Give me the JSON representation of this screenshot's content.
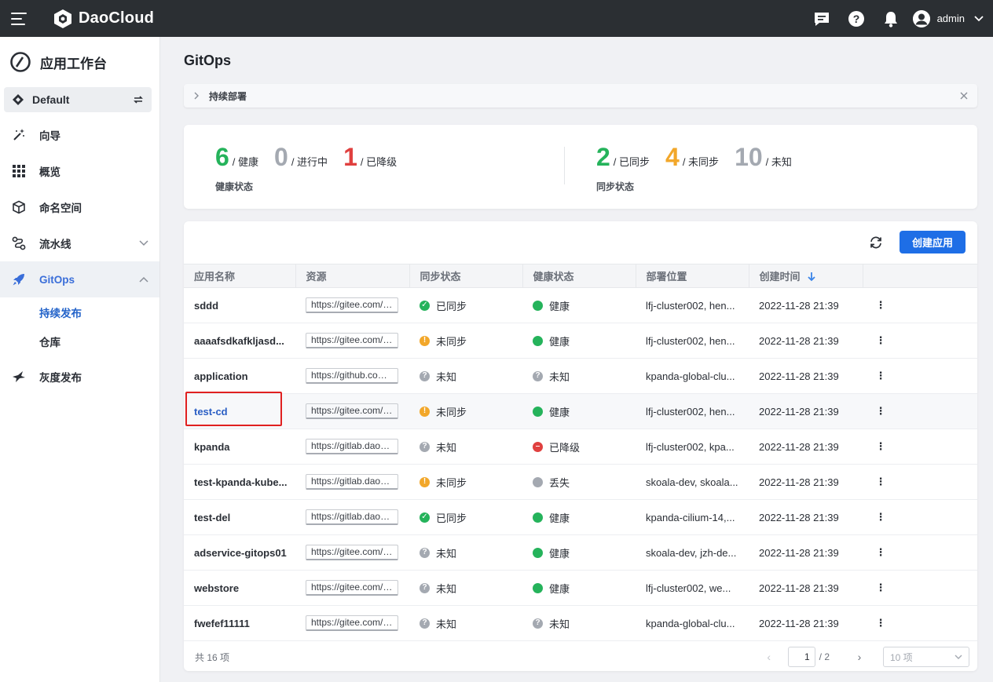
{
  "topbar": {
    "brand": "DaoCloud",
    "user": "admin"
  },
  "sidebar": {
    "title": "应用工作台",
    "workspace": "Default",
    "items": [
      {
        "label": "向导"
      },
      {
        "label": "概览"
      },
      {
        "label": "命名空间"
      },
      {
        "label": "流水线"
      },
      {
        "label": "GitOps"
      }
    ],
    "subitems": [
      {
        "label": "持续发布"
      },
      {
        "label": "仓库"
      }
    ],
    "last_item": "灰度发布"
  },
  "page": {
    "title": "GitOps",
    "breadcrumb": "持续部署"
  },
  "stats": {
    "health": {
      "caption": "健康状态",
      "items": [
        {
          "num": "6",
          "label": "/ 健康",
          "color": "#25b35b"
        },
        {
          "num": "0",
          "label": "/ 进行中",
          "color": "#a4a9b1"
        },
        {
          "num": "1",
          "label": "/ 已降级",
          "color": "#e0403f"
        }
      ]
    },
    "sync": {
      "caption": "同步状态",
      "items": [
        {
          "num": "2",
          "label": "/ 已同步",
          "color": "#25b35b"
        },
        {
          "num": "4",
          "label": "/ 未同步",
          "color": "#f2a72a"
        },
        {
          "num": "10",
          "label": "/ 未知",
          "color": "#a4a9b1"
        }
      ]
    }
  },
  "table": {
    "create_label": "创建应用",
    "columns": [
      "应用名称",
      "资源",
      "同步状态",
      "健康状态",
      "部署位置",
      "创建时间",
      ""
    ],
    "rows": [
      {
        "name": "sddd",
        "resource": "https://gitee.com/z...",
        "sync": "已同步",
        "sync_kind": "ok",
        "health": "健康",
        "health_kind": "healthy",
        "location": "lfj-cluster002, hen...",
        "created": "2022-11-28 21:39"
      },
      {
        "name": "aaaafsdkafkljasd...",
        "resource": "https://gitee.com/z...",
        "sync": "未同步",
        "sync_kind": "warn",
        "health": "健康",
        "health_kind": "healthy",
        "location": "lfj-cluster002, hen...",
        "created": "2022-11-28 21:39"
      },
      {
        "name": "application",
        "resource": "https://github.com/...",
        "sync": "未知",
        "sync_kind": "unknown",
        "health": "未知",
        "health_kind": "unknown",
        "location": "kpanda-global-clu...",
        "created": "2022-11-28 21:39"
      },
      {
        "name": "test-cd",
        "resource": "https://gitee.com/z...",
        "sync": "未同步",
        "sync_kind": "warn",
        "health": "健康",
        "health_kind": "healthy",
        "location": "lfj-cluster002, hen...",
        "created": "2022-11-28 21:39"
      },
      {
        "name": "kpanda",
        "resource": "https://gitlab.daocl...",
        "sync": "未知",
        "sync_kind": "unknown",
        "health": "已降级",
        "health_kind": "degraded",
        "location": "lfj-cluster002, kpa...",
        "created": "2022-11-28 21:39"
      },
      {
        "name": "test-kpanda-kube...",
        "resource": "https://gitlab.daocl...",
        "sync": "未同步",
        "sync_kind": "warn",
        "health": "丢失",
        "health_kind": "missing",
        "location": "skoala-dev, skoala...",
        "created": "2022-11-28 21:39"
      },
      {
        "name": "test-del",
        "resource": "https://gitlab.daocl...",
        "sync": "已同步",
        "sync_kind": "ok",
        "health": "健康",
        "health_kind": "healthy",
        "location": "kpanda-cilium-14,...",
        "created": "2022-11-28 21:39"
      },
      {
        "name": "adservice-gitops01",
        "resource": "https://gitee.com/xi...",
        "sync": "未知",
        "sync_kind": "unknown",
        "health": "健康",
        "health_kind": "healthy",
        "location": "skoala-dev, jzh-de...",
        "created": "2022-11-28 21:39"
      },
      {
        "name": "webstore",
        "resource": "https://gitee.com/xi...",
        "sync": "未知",
        "sync_kind": "unknown",
        "health": "健康",
        "health_kind": "healthy",
        "location": "lfj-cluster002, we...",
        "created": "2022-11-28 21:39"
      },
      {
        "name": "fwefef11111",
        "resource": "https://gitee.com/z...",
        "sync": "未知",
        "sync_kind": "unknown",
        "health": "未知",
        "health_kind": "unknown",
        "location": "kpanda-global-clu...",
        "created": "2022-11-28 21:39"
      }
    ]
  },
  "pagination": {
    "total": "共 16 项",
    "current": "1",
    "pages": "/ 2",
    "page_size": "10 项"
  }
}
